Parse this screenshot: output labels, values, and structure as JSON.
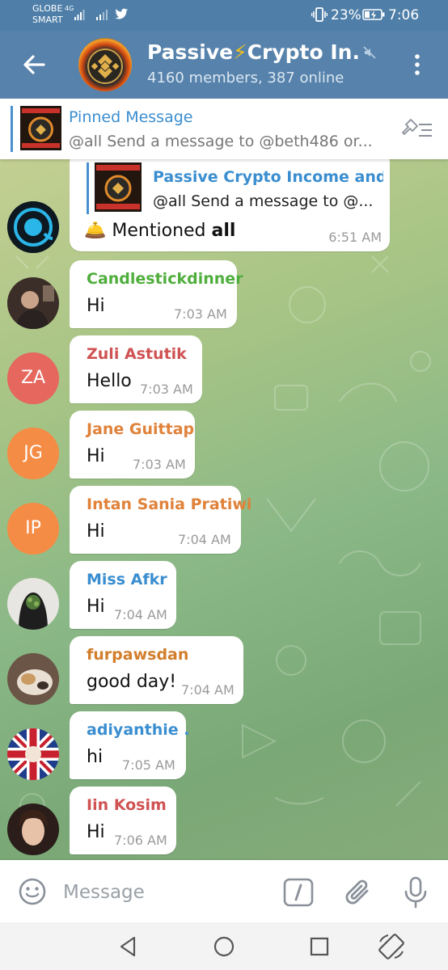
{
  "status_bar": {
    "carrier_1": "GLOBE",
    "carrier_2": "SMART",
    "network": "4G",
    "battery": "23%",
    "time": "7:06"
  },
  "header": {
    "title_part1": "Passive",
    "title_bolt": "⚡",
    "title_part2": "Crypto In...",
    "subtitle": "4160 members, 387 online"
  },
  "pinned": {
    "label": "Pinned Message",
    "text": "@all  Send a message to @beth486 or..."
  },
  "forwarded": {
    "reply_title": "Passive Crypto Income and...",
    "reply_text": "@all  Send a message to @...",
    "mention_prefix": "Mentioned ",
    "mention_target": "all",
    "time": "6:51 AM"
  },
  "messages": [
    {
      "sender": "Candlestickdinner",
      "text": "Hi",
      "time": "7:03 AM",
      "color": "#4fae3c"
    },
    {
      "sender": "Zuli Astutik",
      "text": "Hello",
      "time": "7:03 AM",
      "color": "#d05253",
      "initials": "ZA",
      "avatar_color": "#e5675e"
    },
    {
      "sender": "Jane Guittap",
      "text": "Hi",
      "time": "7:03 AM",
      "color": "#e0823a",
      "initials": "JG",
      "avatar_color": "#f58c45"
    },
    {
      "sender": "Intan Sania Pratiwi",
      "text": "Hi",
      "time": "7:04 AM",
      "color": "#e0823a",
      "initials": "IP",
      "avatar_color": "#f58c45"
    },
    {
      "sender": "Miss Afkr",
      "text": "Hi",
      "time": "7:04 AM",
      "color": "#3a8ed0"
    },
    {
      "sender": "furpawsdan",
      "text": "good day!",
      "time": "7:04 AM",
      "color": "#d27e2c"
    },
    {
      "sender": "adiyanthie .",
      "text": "hi",
      "time": "7:05 AM",
      "color": "#3a8ed0"
    },
    {
      "sender": "Iin Kosim",
      "text": "Hi",
      "time": "7:06 AM",
      "color": "#d05253"
    }
  ],
  "composer": {
    "placeholder": "Message"
  },
  "icons": {
    "back": "back-arrow-icon",
    "mute": "muted-speaker-icon",
    "menu": "more-vertical-icon",
    "unpin": "unpin-icon",
    "emoji": "emoji-icon",
    "commands": "bot-command-icon",
    "attach": "paperclip-icon",
    "mic": "microphone-icon"
  }
}
